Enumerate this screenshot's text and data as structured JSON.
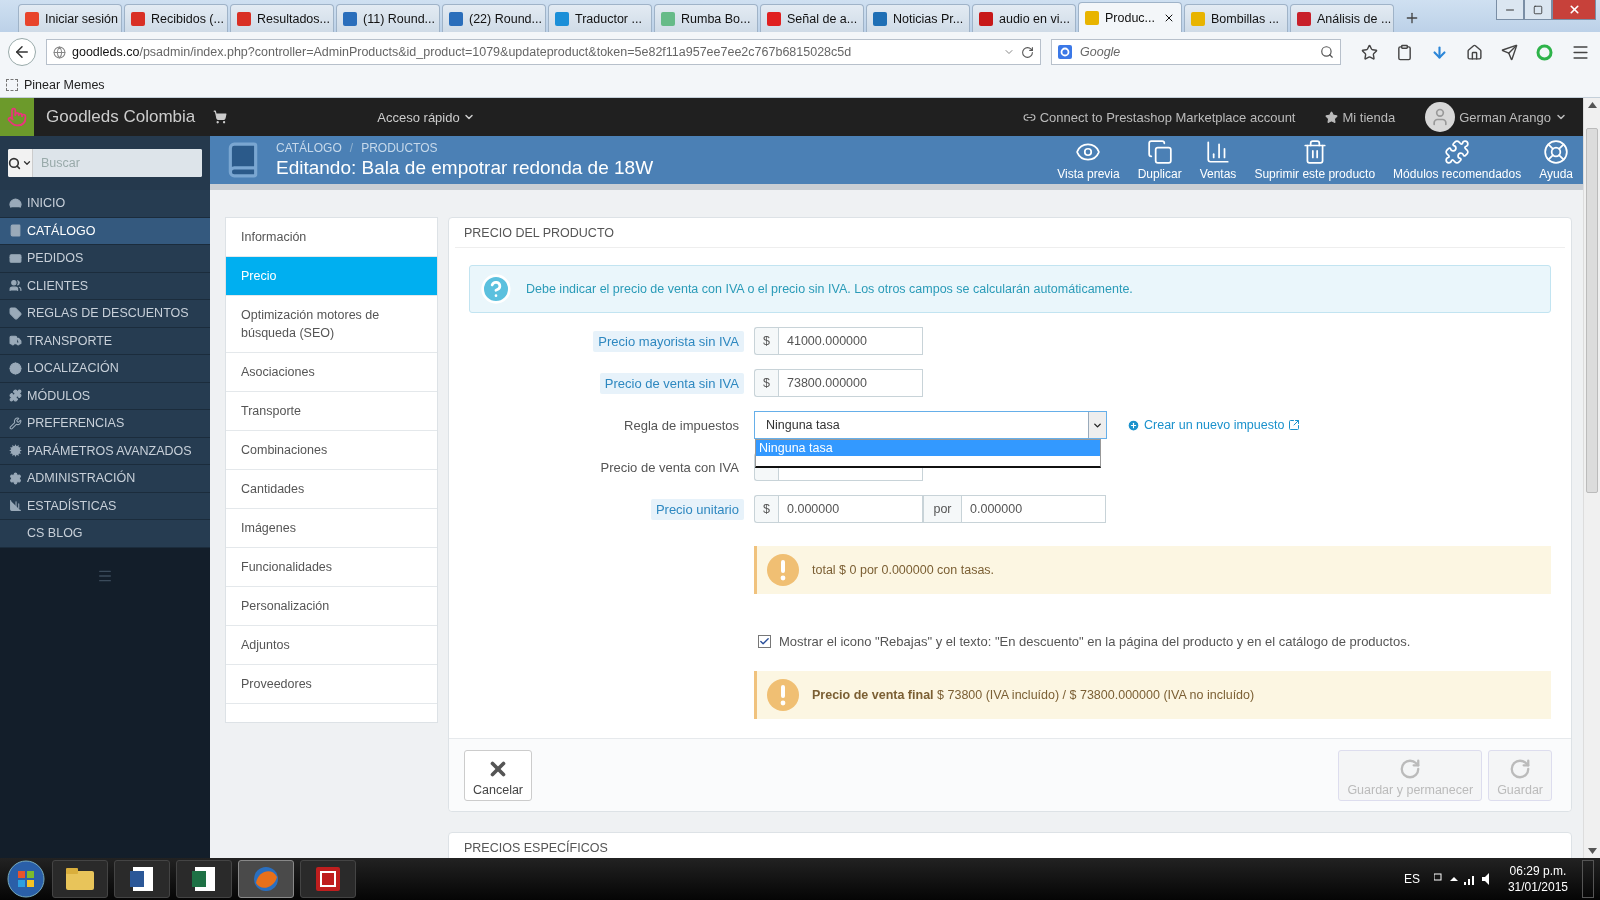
{
  "browser": {
    "tabs": [
      {
        "label": "Iniciar sesión",
        "selected": false
      },
      {
        "label": "Recibidos (...",
        "selected": false
      },
      {
        "label": "Resultados...",
        "selected": false
      },
      {
        "label": "(11) Round...",
        "selected": false
      },
      {
        "label": "(22) Round...",
        "selected": false
      },
      {
        "label": "Traductor ...",
        "selected": false
      },
      {
        "label": "Rumba Bo...",
        "selected": false
      },
      {
        "label": "Señal de a...",
        "selected": false
      },
      {
        "label": "Noticias Pr...",
        "selected": false
      },
      {
        "label": "audio en vi...",
        "selected": false
      },
      {
        "label": "Produc...",
        "selected": true
      },
      {
        "label": "Bombillas ...",
        "selected": false
      },
      {
        "label": "Análisis de ...",
        "selected": false
      }
    ],
    "url_host": "goodleds.co",
    "url_path": "/psadmin/index.php?controller=AdminProducts&id_product=1079&updateproduct&token=5e82f11a957ee7ee2c767b6815028c5d",
    "search_placeholder": "Google",
    "bookmarks": [
      "Pinear Memes"
    ]
  },
  "admin_header": {
    "shop_name": "Goodleds Colombia",
    "quick_access": "Acceso rápido",
    "marketplace": "Connect to Prestashop Marketplace account",
    "my_shop": "Mi tienda",
    "user": "German Arango"
  },
  "sidebar": {
    "search_placeholder": "Buscar",
    "items": [
      {
        "label": "INICIO",
        "selected": false
      },
      {
        "label": "CATÁLOGO",
        "selected": true
      },
      {
        "label": "PEDIDOS",
        "selected": false
      },
      {
        "label": "CLIENTES",
        "selected": false
      },
      {
        "label": "REGLAS DE DESCUENTOS",
        "selected": false
      },
      {
        "label": "TRANSPORTE",
        "selected": false
      },
      {
        "label": "LOCALIZACIÓN",
        "selected": false
      },
      {
        "label": "MÓDULOS",
        "selected": false
      },
      {
        "label": "PREFERENCIAS",
        "selected": false
      },
      {
        "label": "PARÁMETROS AVANZADOS",
        "selected": false
      },
      {
        "label": "ADMINISTRACIÓN",
        "selected": false
      },
      {
        "label": "ESTADÍSTICAS",
        "selected": false
      },
      {
        "label": "CS BLOG",
        "selected": false
      }
    ]
  },
  "page_header": {
    "breadcrumb": [
      "CATÁLOGO",
      "PRODUCTOS"
    ],
    "breadcrumb_separator": "/",
    "title": "Editando: Bala de empotrar redonda de 18W",
    "toolbar": [
      "Vista previa",
      "Duplicar",
      "Ventas",
      "Suprimir este producto",
      "Módulos recomendados",
      "Ayuda"
    ]
  },
  "product_tabs": [
    {
      "label": "Información",
      "selected": false
    },
    {
      "label": "Precio",
      "selected": true
    },
    {
      "label": "Optimización motores de búsqueda (SEO)",
      "selected": false
    },
    {
      "label": "Asociaciones",
      "selected": false
    },
    {
      "label": "Transporte",
      "selected": false
    },
    {
      "label": "Combinaciones",
      "selected": false
    },
    {
      "label": "Cantidades",
      "selected": false
    },
    {
      "label": "Imágenes",
      "selected": false
    },
    {
      "label": "Funcionalidades",
      "selected": false
    },
    {
      "label": "Personalización",
      "selected": false
    },
    {
      "label": "Adjuntos",
      "selected": false
    },
    {
      "label": "Proveedores",
      "selected": false
    }
  ],
  "panel": {
    "heading": "PRECIO DEL PRODUCTO",
    "info": "Debe indicar el precio de venta con IVA o el precio sin IVA. Los otros campos se calcularán automáticamente.",
    "fields": [
      {
        "kind": "money",
        "label": "Precio mayorista sin IVA",
        "label_hint": true,
        "prefix": "$",
        "value": "41000.000000"
      },
      {
        "kind": "money",
        "label": "Precio de venta sin IVA",
        "label_hint": true,
        "prefix": "$",
        "value": "73800.000000"
      },
      {
        "kind": "select",
        "label": "Regla de impuestos",
        "label_hint": false,
        "value": "Ninguna tasa",
        "expanded": true,
        "options": [
          {
            "label": "Ninguna tasa",
            "selected": true
          }
        ],
        "link": "Crear un nuevo impuesto"
      },
      {
        "kind": "money",
        "label": "Precio de venta con IVA",
        "label_hint": false
      },
      {
        "kind": "unit",
        "label": "Precio unitario",
        "label_hint": true,
        "prefix": "$",
        "value": "0.000000",
        "per": "por",
        "per_value": "0.000000"
      }
    ],
    "unit_note": "total $ 0 por 0.000000 con tasas.",
    "on_sale": {
      "checked": true,
      "label": "Mostrar el icono \"Rebajas\" y el texto: \"En descuento\" en la página del producto y en el catálogo de productos."
    },
    "final_price": "**Precio de venta final** $ 73800 (IVA incluído) / $ 73800.000000 (IVA no incluído)",
    "cancel": "Cancelar",
    "save_buttons": [
      {
        "label": "Guardar y permanecer",
        "disabled": true
      },
      {
        "label": "Guardar",
        "disabled": true
      }
    ]
  },
  "next_panel": {
    "heading": "PRECIOS ESPECÍFICOS"
  },
  "taskbar": {
    "language": "ES",
    "time": "06:29 p.m.",
    "date": "31/01/2015"
  }
}
